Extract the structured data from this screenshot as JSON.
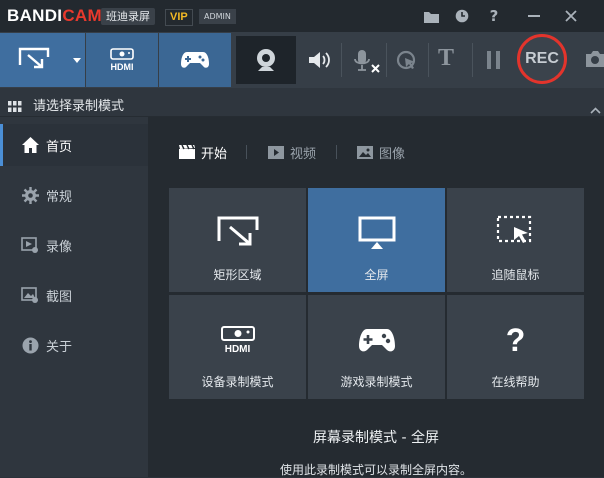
{
  "app": {
    "brand_a": "BANDI",
    "brand_b": "CAM",
    "name_cn": "班迪录屏",
    "vip": "VIP",
    "admin": "ADMIN"
  },
  "toolbar": {
    "hdmi_label": "HDMI",
    "rec_label": "REC",
    "text_tool": "T"
  },
  "section": {
    "title": "请选择录制模式"
  },
  "sidebar": {
    "items": [
      {
        "label": "首页",
        "icon": "home-icon"
      },
      {
        "label": "常规",
        "icon": "gear-icon"
      },
      {
        "label": "录像",
        "icon": "video-settings-icon"
      },
      {
        "label": "截图",
        "icon": "image-settings-icon"
      },
      {
        "label": "关于",
        "icon": "info-icon"
      }
    ]
  },
  "tabs": [
    {
      "label": "开始",
      "icon": "clapperboard-icon"
    },
    {
      "label": "视频",
      "icon": "play-icon"
    },
    {
      "label": "图像",
      "icon": "image-icon"
    }
  ],
  "modes": [
    {
      "label": "矩形区域",
      "icon": "rectangle-area-icon"
    },
    {
      "label": "全屏",
      "icon": "monitor-icon"
    },
    {
      "label": "追随鼠标",
      "icon": "follow-mouse-icon"
    },
    {
      "label": "设备录制模式",
      "icon": "hdmi-device-icon",
      "badge": "HDMI"
    },
    {
      "label": "游戏录制模式",
      "icon": "gamepad-icon"
    },
    {
      "label": "在线帮助",
      "icon": "help-icon",
      "glyph": "?"
    }
  ],
  "description": {
    "title": "屏幕录制模式 - 全屏",
    "text": "使用此录制模式可以录制全屏内容。"
  },
  "colors": {
    "accent": "#3f6e9f",
    "rec_ring": "#e3342c",
    "brand_red": "#e8392d",
    "vip": "#f2b824"
  }
}
